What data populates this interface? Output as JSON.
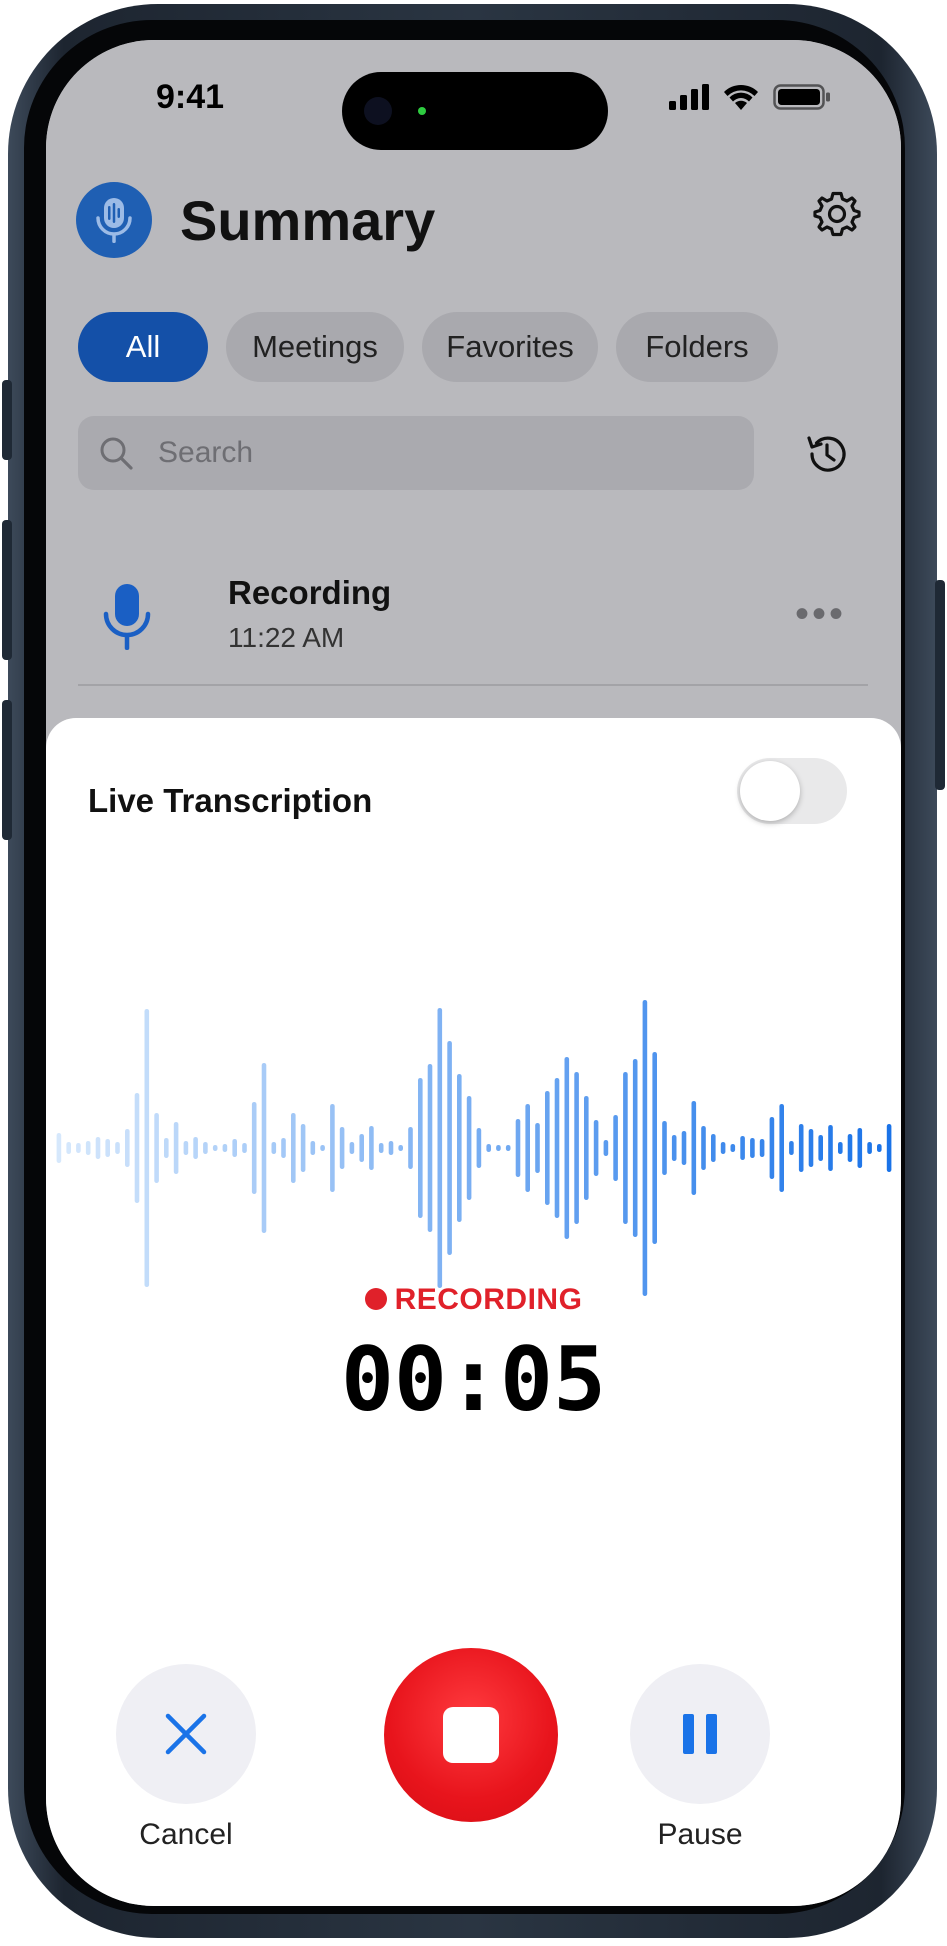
{
  "status_bar": {
    "time": "9:41"
  },
  "header": {
    "title": "Summary"
  },
  "filters": [
    {
      "label": "All",
      "active": true
    },
    {
      "label": "Meetings",
      "active": false
    },
    {
      "label": "Favorites",
      "active": false
    },
    {
      "label": "Folders",
      "active": false
    }
  ],
  "search": {
    "placeholder": "Search"
  },
  "recordings": [
    {
      "title": "Recording",
      "time": "11:22 AM"
    }
  ],
  "sheet": {
    "live_transcription_label": "Live Transcription",
    "live_transcription_on": false,
    "status_text": "RECORDING",
    "timer": "00:05",
    "cancel_label": "Cancel",
    "pause_label": "Pause"
  },
  "colors": {
    "accent": "#1450a8",
    "wave_blue": "#1a73e8",
    "record_red": "#e0212a"
  },
  "icons": {
    "app_logo": "mic-waveform-icon",
    "settings": "gear-icon",
    "history": "history-icon",
    "recording_item": "mic-icon",
    "more": "ellipsis-icon",
    "cancel": "close-icon",
    "stop": "stop-icon",
    "pause": "pause-icon"
  }
}
